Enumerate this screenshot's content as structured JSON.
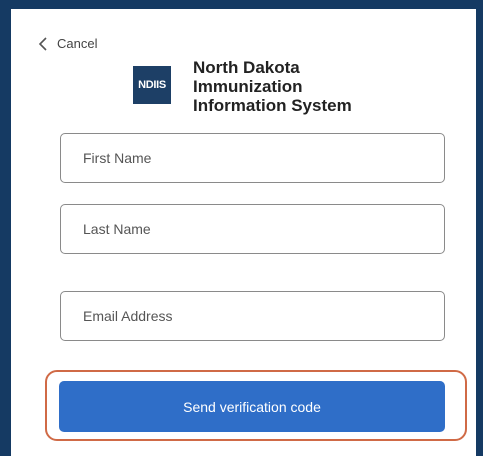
{
  "header": {
    "cancel_label": "Cancel",
    "logo_text": "NDIIS",
    "org_name": "North Dakota Immunization Information System",
    "brand_color": "#1d3f66"
  },
  "form": {
    "first_name": {
      "placeholder": "First Name",
      "value": ""
    },
    "last_name": {
      "placeholder": "Last Name",
      "value": ""
    },
    "email": {
      "placeholder": "Email Address",
      "value": ""
    },
    "submit_label": "Send verification code",
    "submit_color": "#2f6ec8",
    "highlight_color": "#d06a46"
  }
}
